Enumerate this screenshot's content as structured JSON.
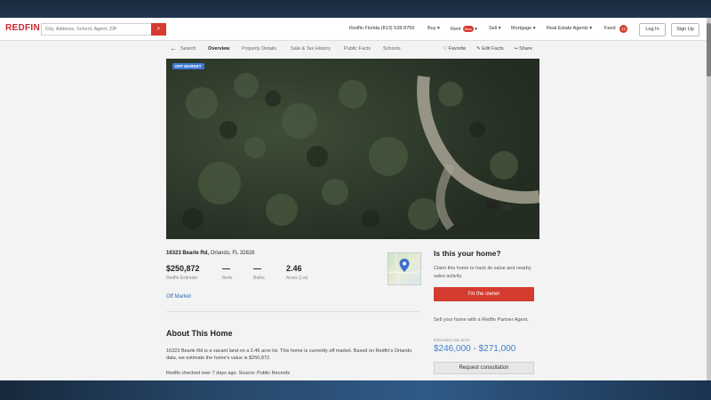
{
  "header": {
    "logo": "REDFIN",
    "search_placeholder": "City, Address, School, Agent, ZIP",
    "phone": "Redfin Florida (813) 528-8756",
    "nav": [
      "Buy",
      "Rent",
      "Sell",
      "Mortgage",
      "Real Estate Agents",
      "Feed"
    ],
    "rent_badge": "New",
    "feed_count": "12",
    "login": "Log In",
    "signup": "Sign Up"
  },
  "tabs": {
    "back": "Search",
    "items": [
      "Overview",
      "Property Details",
      "Sale & Tax History",
      "Public Facts",
      "Schools"
    ],
    "active": "Overview",
    "favorite": "Favorite",
    "edit_facts": "Edit Facts",
    "share": "Share"
  },
  "photo": {
    "badge": "OFF MARKET"
  },
  "listing": {
    "street": "16323 Bearle Rd,",
    "city": "Orlando, FL 32828",
    "price": "$250,872",
    "price_label": "Redfin Estimate",
    "beds": "—",
    "beds_label": "Beds",
    "baths": "—",
    "baths_label": "Baths",
    "acres": "2.46",
    "acres_label": "Acres (Lot)",
    "status_link": "Off Market"
  },
  "about": {
    "title": "About This Home",
    "text": "16323 Bearle Rd is a vacant land on a 2.46 acre lot. This home is currently off market. Based on Redfin's Orlando data, we estimate the home's value is $250,872.",
    "more": "Redfin checked over 7 days ago. Source: Public Records"
  },
  "owner_panel": {
    "title": "Is this your home?",
    "text": "Claim this home to track its value and nearby sales activity.",
    "owner_button": "I'm the owner",
    "sell_text": "Sell your home with a Redfin Partner Agent.",
    "est_label": "Estimated sale price",
    "est_range": "$246,000 - $271,000",
    "request_button": "Request consultation"
  }
}
